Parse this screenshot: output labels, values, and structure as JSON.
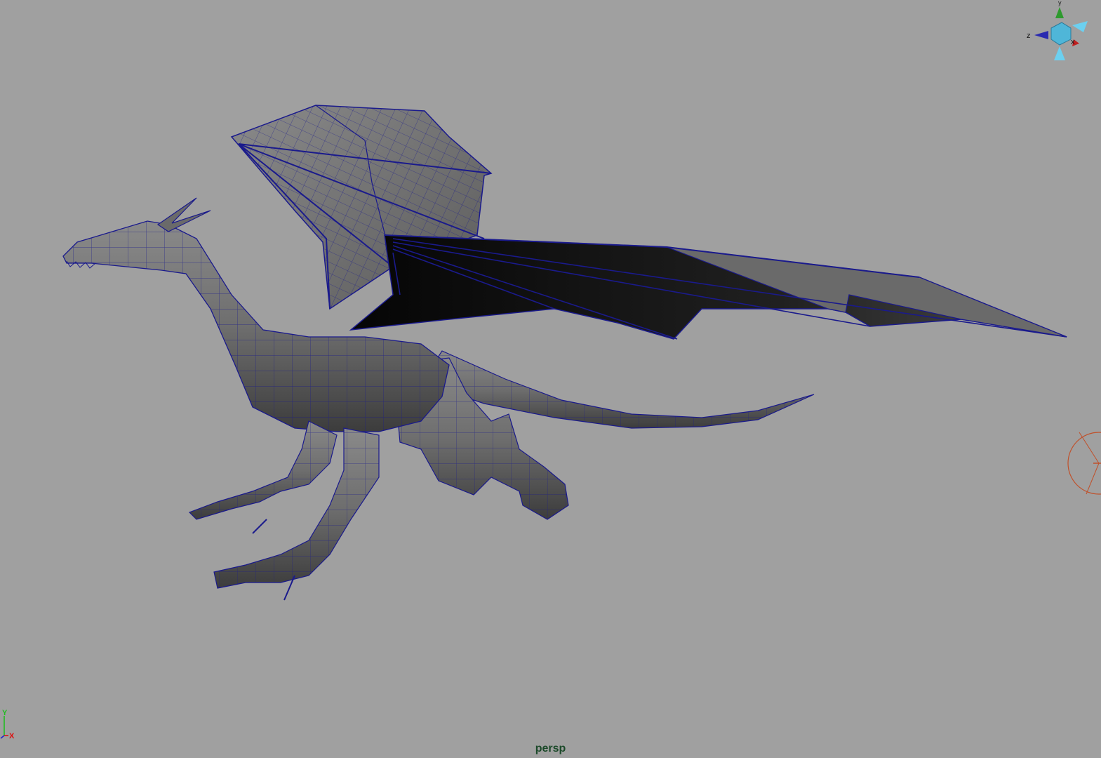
{
  "viewport": {
    "camera_name": "persp",
    "background_color": "#a0a0a0",
    "wireframe_color": "#1a1a8c",
    "shaded_color": "#6a6a6a",
    "camera_label_color": "#1c4a2a"
  },
  "view_cube": {
    "axis_y_label": "y",
    "axis_z_label": "z",
    "axis_x_label": "x",
    "y_color": "#2e9a2e",
    "z_color": "#2a2ab0",
    "x_color": "#c02020",
    "cube_color": "#4fb6d8"
  },
  "origin_axis": {
    "y_label": "Y",
    "x_label": "X",
    "y_color": "#22bb22",
    "x_color": "#dd1111"
  },
  "scene_object": {
    "icon": "dragon-mesh-icon"
  },
  "light_gizmo": {
    "icon": "spotlight-icon",
    "color": "#c0502a"
  }
}
